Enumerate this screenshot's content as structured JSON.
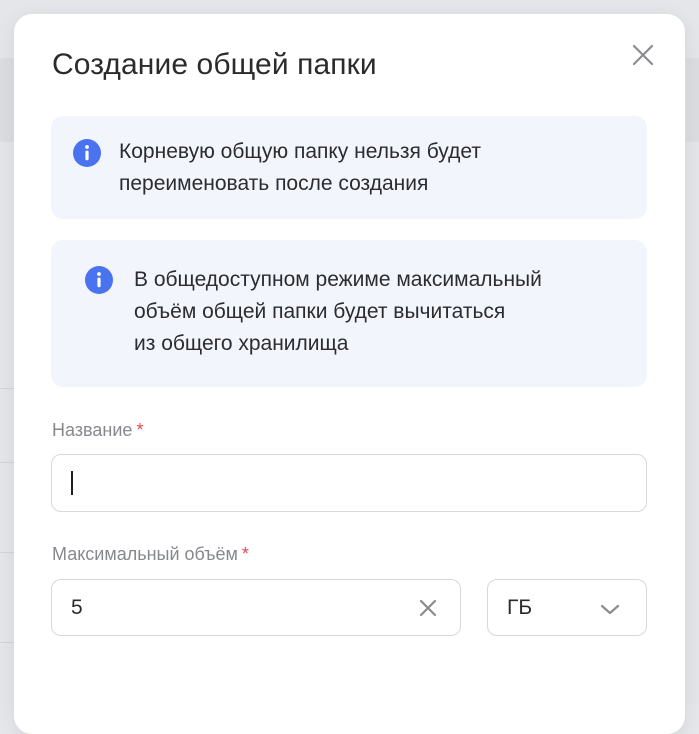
{
  "dialog": {
    "title": "Создание общей папки",
    "close_icon": "close-icon"
  },
  "info": [
    {
      "icon": "info-icon",
      "text": "Корневую общую папку нельзя будет\nпереименовать после создания"
    },
    {
      "icon": "info-icon",
      "text": "В общедоступном режиме максимальный\nобъём общей папки будет вычитаться\nиз общего хранилища"
    }
  ],
  "form": {
    "name": {
      "label": "Название",
      "required_mark": "*",
      "value": ""
    },
    "max_volume": {
      "label": "Максимальный объём",
      "required_mark": "*",
      "value": "5",
      "clear_icon": "clear-icon"
    },
    "unit": {
      "selected": "ГБ",
      "icon": "chevron-down-icon"
    }
  },
  "colors": {
    "info_background": "#f2f5fc",
    "info_icon": "#4a73f0",
    "required": "#e5484d",
    "label": "#86888e",
    "border": "#d6d8de"
  }
}
